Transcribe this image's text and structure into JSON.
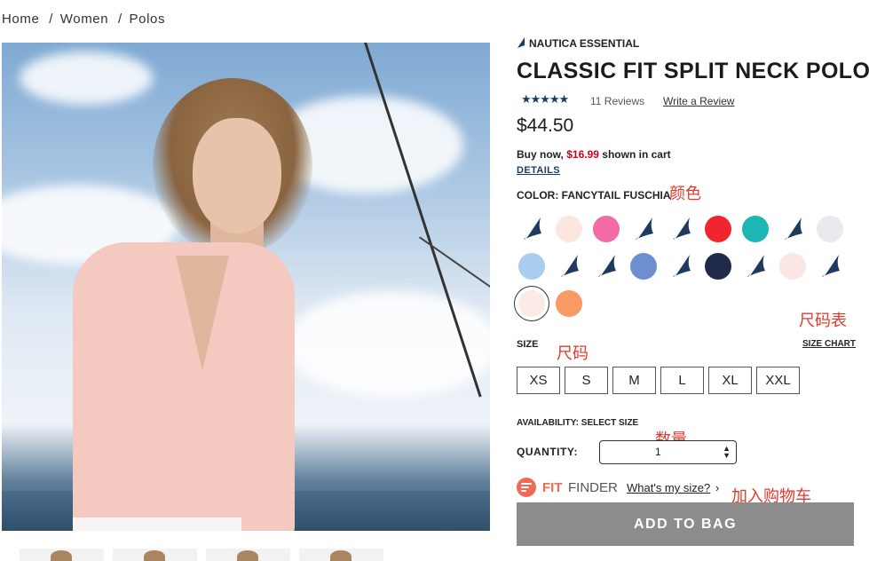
{
  "breadcrumb": {
    "home": "Home",
    "sep1": "/",
    "women": "Women",
    "sep2": "/",
    "polos": "Polos"
  },
  "product": {
    "brand": "NAUTICA ESSENTIAL",
    "title": "CLASSIC FIT SPLIT NECK POLO",
    "rating": 4.5,
    "stars": "★★★★★",
    "reviews": "11 Reviews",
    "write_review": "Write a Review",
    "price": "$44.50",
    "promo_prefix": "Buy now,",
    "promo_price": "$16.99",
    "promo_suffix": "shown in cart",
    "details": "DETAILS",
    "color_label": "COLOR: FANCYTAIL FUSCHIA"
  },
  "swatches": [
    {
      "type": "sail",
      "color": "#1e3a5f"
    },
    {
      "type": "solid",
      "color": "#fbe6e0"
    },
    {
      "type": "solid",
      "color": "#f36aa5"
    },
    {
      "type": "sail",
      "color": "#1e3a5f"
    },
    {
      "type": "sail",
      "color": "#1e3a5f"
    },
    {
      "type": "solid",
      "color": "#f0252f"
    },
    {
      "type": "solid",
      "color": "#1cb6b5"
    },
    {
      "type": "sail",
      "color": "#1e3a5f"
    },
    {
      "type": "solid",
      "color": "#e9e9ef"
    },
    {
      "type": "solid",
      "color": "#a9cdef"
    },
    {
      "type": "sail",
      "color": "#1e3a5f"
    },
    {
      "type": "sail",
      "color": "#1e3a5f"
    },
    {
      "type": "solid",
      "color": "#6d8fd0"
    },
    {
      "type": "sail",
      "color": "#1e3a5f"
    },
    {
      "type": "solid",
      "color": "#1f2a4a"
    },
    {
      "type": "sail",
      "color": "#1e3a5f"
    },
    {
      "type": "solid",
      "color": "#fbe6e6"
    },
    {
      "type": "sail",
      "color": "#1e3a5f"
    },
    {
      "type": "solid",
      "color": "#fbeae6",
      "selected": true
    },
    {
      "type": "solid",
      "color": "#f89a63"
    }
  ],
  "size": {
    "label": "SIZE",
    "chart_link": "SIZE CHART",
    "options": [
      "XS",
      "S",
      "M",
      "L",
      "XL",
      "XXL"
    ]
  },
  "availability": "AVAILABILITY: SELECT SIZE",
  "quantity": {
    "label": "QUANTITY:",
    "value": "1"
  },
  "fit_finder": {
    "fit": "FIT",
    "finder": "FINDER",
    "link": "What's my size?",
    "chevron": "›"
  },
  "add_to_bag": "ADD TO BAG",
  "annotations": {
    "color": "颜色",
    "size_chart": "尺码表",
    "size": "尺码",
    "quantity": "数量",
    "add_to_cart": "加入购物车"
  },
  "colors": {
    "accent_red": "#d0021b",
    "navy": "#1e3a5f",
    "fit_coral": "#f06a5a",
    "button_gray": "#8c8c8c",
    "annotation_red": "#e03a2e"
  }
}
